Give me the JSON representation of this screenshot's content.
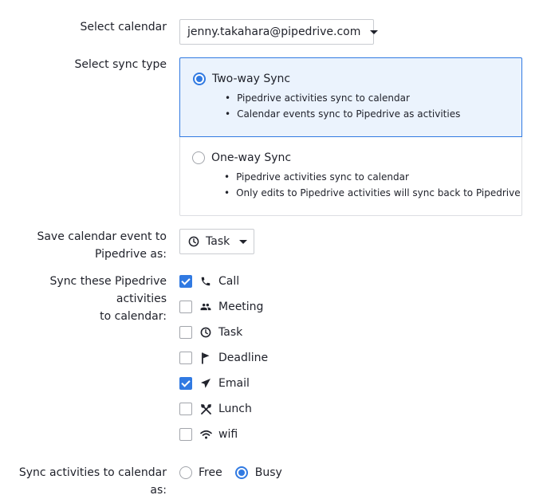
{
  "form": {
    "select_calendar_label": "Select calendar",
    "calendar_value": "jenny.takahara@pipedrive.com",
    "sync_type_label": "Select sync type",
    "sync_options": [
      {
        "title": "Two-way Sync",
        "selected": true,
        "bullets": [
          "Pipedrive activities sync to calendar",
          "Calendar events sync to Pipedrive as activities"
        ]
      },
      {
        "title": "One-way Sync",
        "selected": false,
        "bullets": [
          "Pipedrive activities sync to calendar",
          "Only edits to Pipedrive activities will sync back to Pipedrive"
        ]
      }
    ],
    "save_event_label_line1": "Save calendar event to",
    "save_event_label_line2": "Pipedrive as:",
    "save_event_value": "Task",
    "sync_activities_label_line1": "Sync these Pipedrive activities",
    "sync_activities_label_line2": "to calendar:",
    "activities": [
      {
        "label": "Call",
        "checked": true,
        "icon": "phone-icon"
      },
      {
        "label": "Meeting",
        "checked": false,
        "icon": "people-icon"
      },
      {
        "label": "Task",
        "checked": false,
        "icon": "clock-icon"
      },
      {
        "label": "Deadline",
        "checked": false,
        "icon": "flag-icon"
      },
      {
        "label": "Email",
        "checked": true,
        "icon": "send-icon"
      },
      {
        "label": "Lunch",
        "checked": false,
        "icon": "cutlery-icon"
      },
      {
        "label": "wifi",
        "checked": false,
        "icon": "wifi-icon"
      }
    ],
    "sync_as_label": "Sync activities to calendar as:",
    "sync_as_options": [
      {
        "label": "Free",
        "selected": false
      },
      {
        "label": "Busy",
        "selected": true
      }
    ]
  },
  "colors": {
    "accent": "#317ae2",
    "selected_bg": "#ebf3fd",
    "border": "#c9ccd1",
    "text": "#21232c"
  }
}
